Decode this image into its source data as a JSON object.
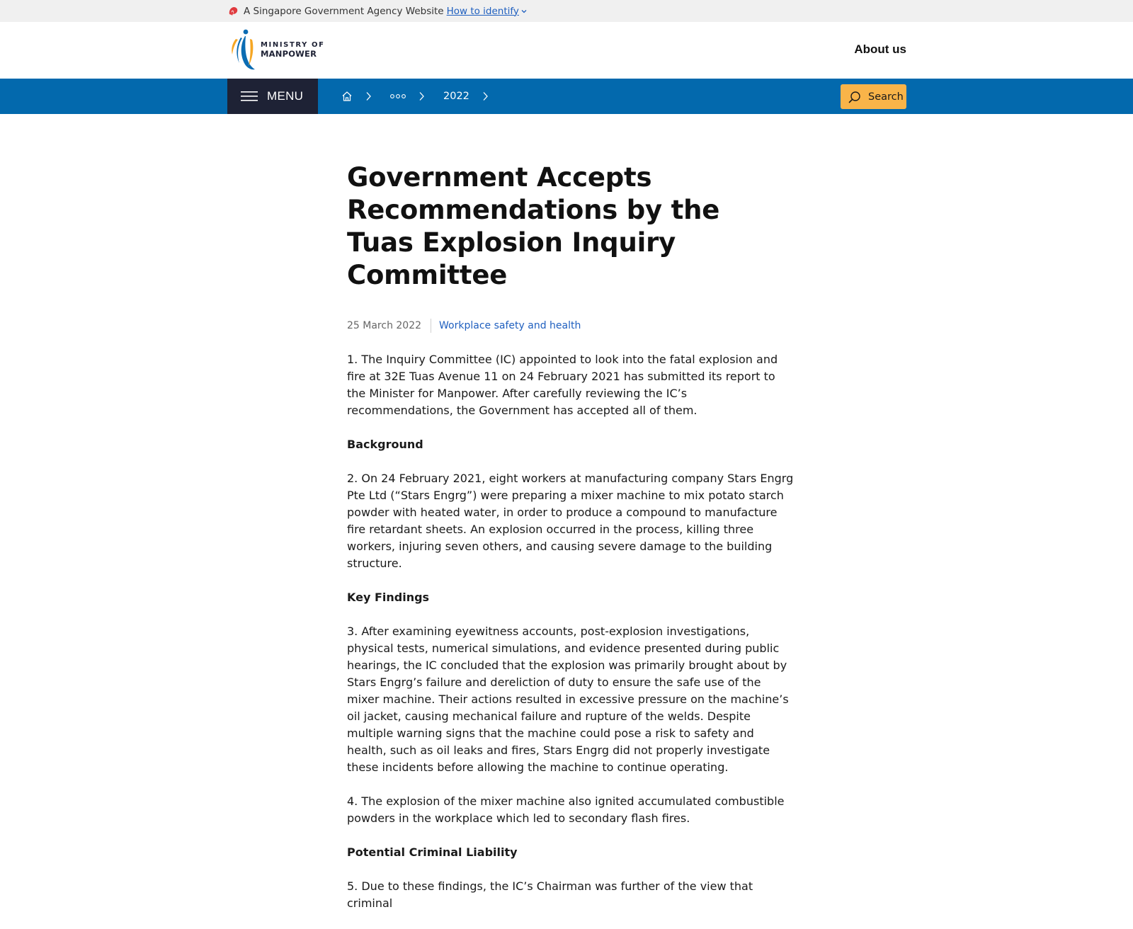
{
  "masthead": {
    "text": "A Singapore Government Agency Website",
    "link_label": "How to identify",
    "icons": [
      "lion-icon",
      "chevron-down-icon"
    ]
  },
  "header": {
    "logo_line1": "MINISTRY OF",
    "logo_line2": "MANPOWER",
    "about_label": "About us"
  },
  "navbar": {
    "menu_label": "MENU",
    "breadcrumb": {
      "home_icon": "home-icon",
      "ellipsis_icon": "ellipsis-icon",
      "year": "2022"
    },
    "search_label": "Search",
    "colors": {
      "bar": "#0369ad",
      "menu": "#1e2235",
      "search": "#f9b449"
    }
  },
  "article": {
    "title": "Government Accepts Recommendations by the Tuas Explosion Inquiry Committee",
    "date": "25 March 2022",
    "tag": "Workplace safety and health",
    "p1": "1. The Inquiry Committee (IC) appointed to look into the fatal explosion and fire at 32E Tuas Avenue 11 on 24 February 2021 has submitted its report to the Minister for Manpower. After carefully reviewing the IC’s recommendations, the Government has accepted all of them.",
    "h_background": "Background",
    "p2": "2. On 24 February 2021, eight workers at manufacturing company Stars Engrg Pte Ltd (“Stars Engrg”) were preparing a mixer machine to mix potato starch powder with heated water, in order to produce a compound to manufacture fire retardant sheets. An explosion occurred in the process, killing three workers, injuring seven others, and causing severe damage to the building structure.",
    "h_findings": "Key Findings",
    "p3": "3. After examining eyewitness accounts, post-explosion investigations, physical tests, numerical simulations, and evidence presented during public hearings, the IC concluded that the explosion was primarily brought about by Stars Engrg’s failure and dereliction of duty to ensure the safe use of the mixer machine. Their actions resulted in excessive pressure on the machine’s oil jacket, causing mechanical failure and rupture of the welds. Despite multiple warning signs that the machine could pose a risk to safety and health, such as oil leaks and fires, Stars Engrg did not properly investigate these incidents before allowing the machine to continue operating.",
    "p4": "4. The explosion of the mixer machine also ignited accumulated combustible powders in the workplace which led to secondary flash fires.",
    "h_liability": "Potential Criminal Liability",
    "p5": "5. Due to these findings, the IC’s Chairman was further of the view that criminal"
  }
}
